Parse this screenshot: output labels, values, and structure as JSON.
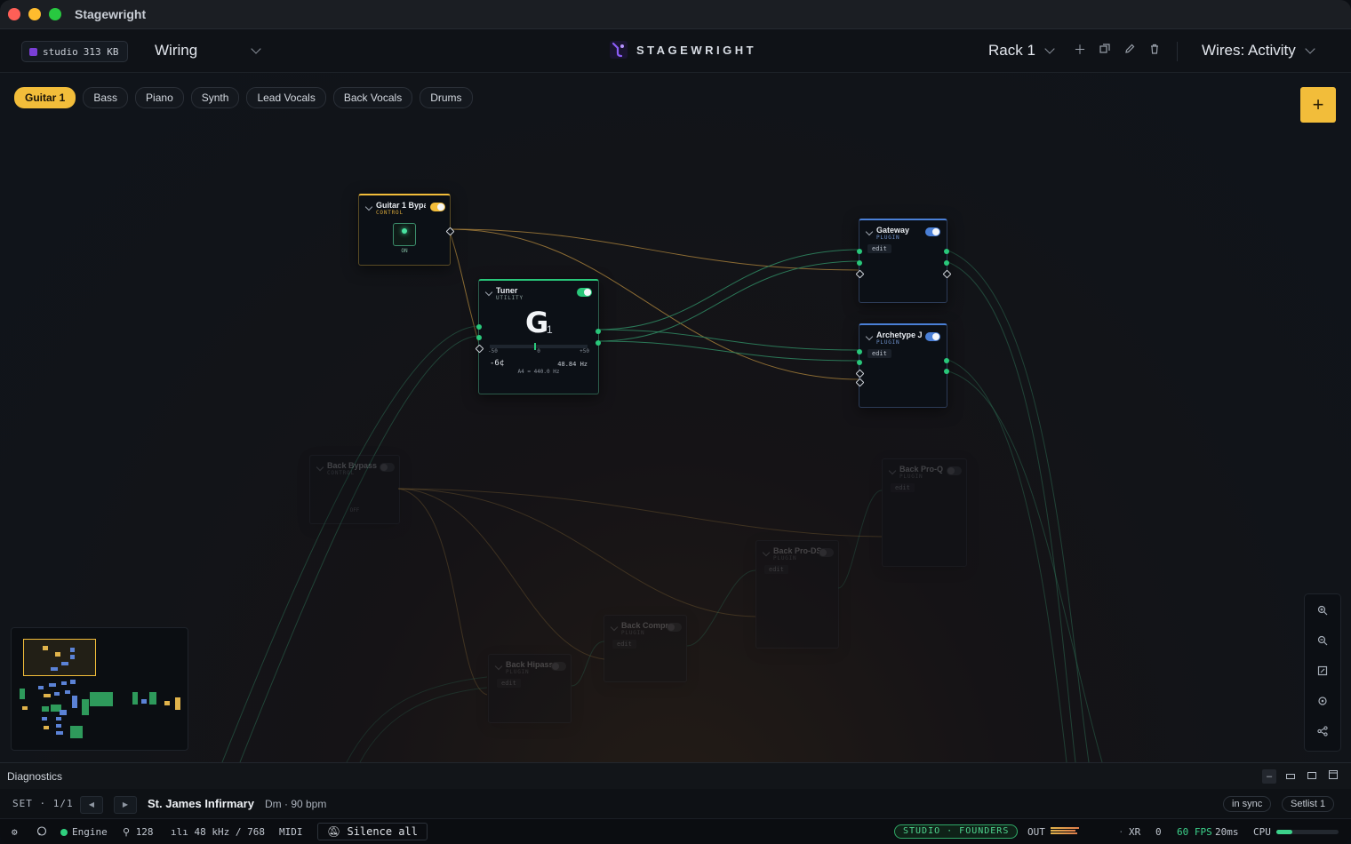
{
  "window": {
    "title": "Stagewright"
  },
  "toolbar": {
    "studio_label": "studio",
    "studio_size": "313 KB",
    "view_mode": "Wiring",
    "brand": "STAGEWRIGHT",
    "rack": "Rack 1",
    "wires_mode": "Wires: Activity"
  },
  "tabs": [
    "Guitar 1",
    "Bass",
    "Piano",
    "Synth",
    "Lead Vocals",
    "Back Vocals",
    "Drums"
  ],
  "active_tab": "Guitar 1",
  "add_button": "+",
  "nodes": {
    "guitar_bypass": {
      "title": "Guitar 1 Bypass",
      "subtitle": "CONTROL",
      "state": "ON",
      "accent": "#f2bd3a"
    },
    "tuner": {
      "title": "Tuner",
      "subtitle": "UTILITY",
      "note": "G",
      "octave": "1",
      "scale_left": "-50",
      "scale_mid": "0",
      "scale_right": "+50",
      "cents": "-6¢",
      "frequency": "48.84 Hz",
      "reference": "A4 = 440.0 Hz",
      "accent": "#29c77a"
    },
    "gateway": {
      "title": "Gateway",
      "subtitle": "PLUGIN",
      "edit": "edit",
      "accent": "#4a7fd6"
    },
    "archetype": {
      "title": "Archetype J",
      "subtitle": "PLUGIN",
      "edit": "edit",
      "accent": "#4a7fd6"
    },
    "back_bypass": {
      "title": "Back Bypass",
      "subtitle": "CONTROL",
      "state": "OFF"
    },
    "back_proq": {
      "title": "Back Pro-Q",
      "subtitle": "PLUGIN",
      "edit": "edit"
    },
    "back_prods": {
      "title": "Back Pro-DS",
      "subtitle": "PLUGIN",
      "edit": "edit"
    },
    "back_comp": {
      "title": "Back Compr",
      "subtitle": "PLUGIN",
      "edit": "edit"
    },
    "back_hipass": {
      "title": "Back Hipass",
      "subtitle": "PLUGIN",
      "edit": "edit"
    }
  },
  "diagnostics": {
    "title": "Diagnostics"
  },
  "setbar": {
    "label": "SET",
    "position": "1/1",
    "song": "St. James Infirmary",
    "meta": "Dm · 90 bpm",
    "sync": "in sync",
    "setlist": "Setlist 1"
  },
  "status": {
    "engine": "Engine",
    "buffer": "128",
    "rate": "48 kHz / 768",
    "midi": "MIDI",
    "silence": "Silence all",
    "badge": "STUDIO · FOUNDERS",
    "out": "OUT",
    "xr_label": "XR",
    "xr_value": "0",
    "fps": "60 FPS",
    "latency": "20ms",
    "cpu": "CPU",
    "cpu_level": 0.25
  },
  "colors": {
    "accent": "#f2bd3a",
    "active_green": "#29c77a",
    "plugin_blue": "#4a7fd6"
  }
}
